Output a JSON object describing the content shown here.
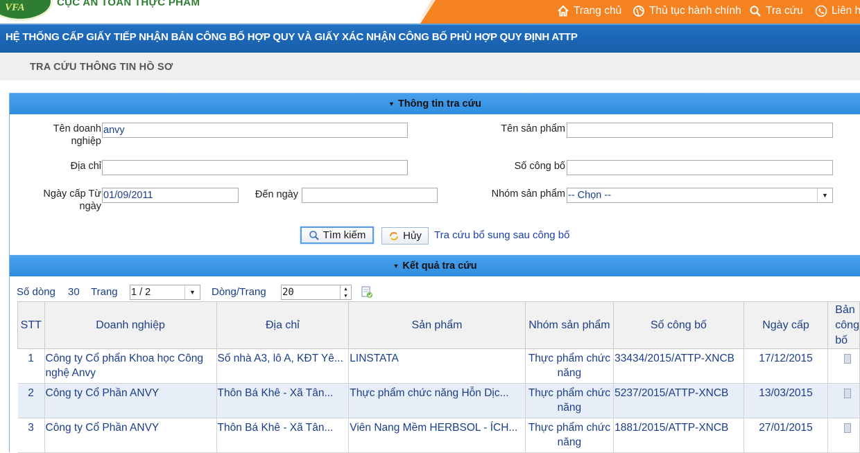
{
  "header": {
    "agency_name": "CỤC AN TOÀN THỰC PHẨM",
    "logo_text": "VFA",
    "nav": [
      {
        "label": "Trang chủ",
        "icon": "home-icon"
      },
      {
        "label": "Thủ tục hành chính",
        "icon": "globe-icon"
      },
      {
        "label": "Tra cứu",
        "icon": "search-icon"
      },
      {
        "label": "Liên hệ",
        "icon": "phone-icon"
      }
    ],
    "colors": {
      "nav_orange": "#f58220",
      "title_blue": "#1b65b4",
      "panel_blue": "#3a95e5",
      "logo_green": "#2f7d32"
    }
  },
  "title_bar": {
    "text": "HỆ THỐNG CẤP GIẤY TIẾP NHẬN BẢN CÔNG BỐ HỢP QUY VÀ GIẤY XÁC NHẬN CÔNG BỐ PHÙ HỢP QUY ĐỊNH ATTP"
  },
  "page_heading": "TRA CỨU THÔNG TIN HỒ SƠ",
  "search_panel": {
    "header": "Thông tin tra cứu",
    "fields": {
      "company": {
        "label": "Tên doanh nghiệp",
        "label_line1": "Tên doanh",
        "label_line2": "nghiệp",
        "value": "anvy"
      },
      "product": {
        "label": "Tên sản phẩm",
        "value": ""
      },
      "address": {
        "label": "Địa chỉ",
        "value": ""
      },
      "announce_no": {
        "label": "Số công bố",
        "value": ""
      },
      "date_from": {
        "label": "Ngày cấp Từ ngày",
        "label_line1": "Ngày cấp Từ",
        "label_line2": "ngày",
        "value": "01/09/2011"
      },
      "date_to": {
        "label": "Đến ngày",
        "value": ""
      },
      "product_group": {
        "label": "Nhóm sản phẩm",
        "value": "-- Chọn --"
      }
    },
    "buttons": {
      "search": "Tìm kiếm",
      "cancel": "Hủy"
    },
    "supplement_link": "Tra cứu bổ sung sau công bố"
  },
  "results_panel": {
    "header": "Kết quả tra cứu",
    "pager": {
      "rows_label": "Số dòng",
      "rows_count": "30",
      "page_label": "Trang",
      "page_value": "1 / 2",
      "per_page_label": "Dòng/Trang",
      "per_page_value": "20"
    },
    "columns": [
      "STT",
      "Doanh nghiệp",
      "Địa chỉ",
      "Sản phẩm",
      "Nhóm sản phẩm",
      "Số công bố",
      "Ngày cấp",
      "Bản công bố"
    ],
    "rows": [
      {
        "stt": "1",
        "company": "Công ty Cổ phẩn Khoa học Công nghệ Anvy",
        "address": "Số nhà A3, lô A, KĐT Yê...",
        "product": "LINSTATA",
        "group": "Thực phẩm chức năng",
        "number": "33434/2015/ATTP-XNCB",
        "date": "17/12/2015"
      },
      {
        "stt": "2",
        "company": "Công ty Cổ Phần ANVY",
        "address": "Thôn Bá Khê - Xã Tân...",
        "product": "Thực phẩm chức năng Hỗn Dịc...",
        "group": "Thực phẩm chức năng",
        "number": "5237/2015/ATTP-XNCB",
        "date": "13/03/2015"
      },
      {
        "stt": "3",
        "company": "Công ty Cổ Phần ANVY",
        "address": "Thôn Bá Khê - Xã Tân...",
        "product": "Viên Nang Mềm HERBSOL - ÍCH...",
        "group": "Thực phẩm chức năng",
        "number": "1881/2015/ATTP-XNCB",
        "date": "27/01/2015"
      }
    ]
  }
}
